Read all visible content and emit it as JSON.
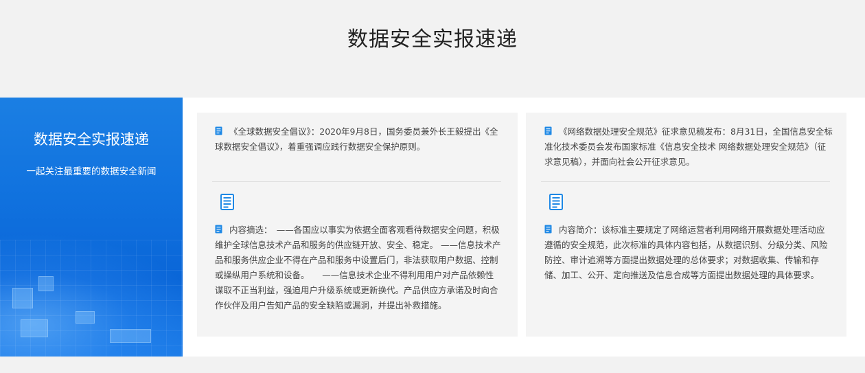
{
  "header": {
    "title": "数据安全实报速递"
  },
  "side_panel": {
    "title": "数据安全实报速递",
    "subtitle": "一起关注最重要的数据安全新闻"
  },
  "cards": [
    {
      "headline": "《全球数据安全倡议》：2020年9月8日，国务委员兼外长王毅提出《全球数据安全倡议》，着重强调应践行数据安全保护原则。",
      "body": "内容摘选：　——各国应以事实为依据全面客观看待数据安全问题，积极维护全球信息技术产品和服务的供应链开放、安全、稳定。 ——信息技术产品和服务供应企业不得在产品和服务中设置后门，非法获取用户数据、控制或操纵用户系统和设备。　　——信息技术企业不得利用用户对产品依赖性谋取不正当利益，强迫用户升级系统或更新换代。产品供应方承诺及时向合作伙伴及用户告知产品的安全缺陷或漏洞，并提出补救措施。",
      "headline_icon": "document-icon",
      "section_icon": "document-icon"
    },
    {
      "headline": "《网络数据处理安全规范》征求意见稿发布：8月31日，全国信息安全标准化技术委员会发布国家标准《信息安全技术 网络数据处理安全规范》（征求意见稿），并面向社会公开征求意见。",
      "body": "内容简介：该标准主要规定了网络运营者利用网络开展数据处理活动应遵循的安全规范，此次标准的具体内容包括，从数据识别、分级分类、风险防控、审计追溯等方面提出数据处理的总体要求；对数据收集、传输和存储、加工、公开、定向推送及信息合成等方面提出数据处理的具体要求。",
      "headline_icon": "document-icon",
      "section_icon": "document-icon"
    }
  ],
  "colors": {
    "accent_blue": "#1173df",
    "icon_blue": "#1e88e5",
    "page_bg": "#f2f2f2",
    "card_bg": "#f4f4f4"
  }
}
